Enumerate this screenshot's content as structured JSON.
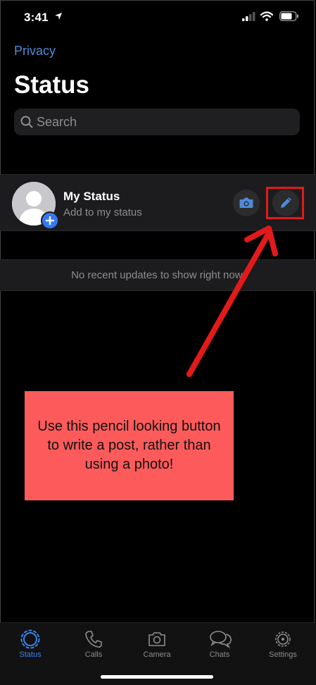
{
  "status_bar": {
    "time": "3:41"
  },
  "header": {
    "back_link": "Privacy",
    "title": "Status"
  },
  "search": {
    "placeholder": "Search"
  },
  "my_status": {
    "title": "My Status",
    "subtitle": "Add to my status"
  },
  "empty_state": {
    "text": "No recent updates to show right now."
  },
  "annotation": {
    "callout_text": "Use this pencil looking button to write a post, rather than using a photo!"
  },
  "tab_bar": {
    "tabs": [
      {
        "label": "Status",
        "icon": "status-ring-icon",
        "active": true
      },
      {
        "label": "Calls",
        "icon": "phone-icon",
        "active": false
      },
      {
        "label": "Camera",
        "icon": "camera-icon",
        "active": false
      },
      {
        "label": "Chats",
        "icon": "chat-bubbles-icon",
        "active": false
      },
      {
        "label": "Settings",
        "icon": "gear-icon",
        "active": false
      }
    ]
  },
  "colors": {
    "accent": "#3478f6",
    "link": "#4f8ad9",
    "annotation_red": "#e21a1a",
    "callout_bg": "#fd5b5b"
  }
}
